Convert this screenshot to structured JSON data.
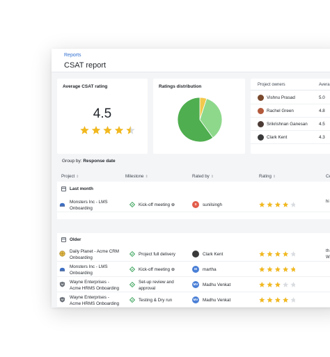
{
  "header": {
    "breadcrumb": "Reports",
    "title": "CSAT report"
  },
  "average_card": {
    "title": "Average CSAT rating",
    "value": "4.5",
    "stars": 4.5
  },
  "distribution_card": {
    "title": "Ratings distribution",
    "chart_data": {
      "type": "pie",
      "slices": [
        {
          "fraction": 0.05,
          "color": "#f2c94c"
        },
        {
          "fraction": 0.35,
          "color": "#8ed88c"
        },
        {
          "fraction": 0.6,
          "color": "#4fae4f"
        }
      ]
    }
  },
  "owners_card": {
    "col_name": "Project owners",
    "col_avg": "Avera",
    "rows": [
      {
        "name": "Vishnu Prasad",
        "value": "5.0",
        "avatar_color": "#7a4a2e"
      },
      {
        "name": "Rachel Green",
        "value": "4.8",
        "avatar_color": "#b25a3c"
      },
      {
        "name": "Srikrishnan Ganesan",
        "value": "4.5",
        "avatar_color": "#4b3b34"
      },
      {
        "name": "Clark Kent",
        "value": "4.3",
        "avatar_color": "#3a3a3a"
      }
    ]
  },
  "groupby": {
    "label": "Group by:",
    "value": "Response date"
  },
  "table": {
    "columns": {
      "project": "Project",
      "milestone": "Milestone",
      "rated_by": "Rated by",
      "rating": "Rating",
      "ce": "Ce"
    },
    "groups": [
      {
        "label": "Last month",
        "rows": [
          {
            "project_1": "Monsters Inc - LMS",
            "project_2": "Onboarding",
            "icon": "monster-logo-icon",
            "milestone_1": "Kick-off meeting ⊕",
            "milestone_2": "",
            "rater": "sunilsingh",
            "rater_initials": "S",
            "rater_color": "#e25c4a",
            "rating": 4,
            "ce_1": "hi",
            "ce_2": ""
          }
        ]
      },
      {
        "label": "Older",
        "rows": [
          {
            "project_1": "Daily Planet - Acme CRM",
            "project_2": "Onboarding",
            "icon": "globe-logo-icon",
            "milestone_1": "Project full delivery",
            "milestone_2": "",
            "rater": "Clark Kent",
            "rater_initials": "",
            "rater_color": "#3a3a3a",
            "rating": 4,
            "ce_1": "th",
            "ce_2": "W"
          },
          {
            "project_1": "Monsters Inc - LMS",
            "project_2": "Onboarding",
            "icon": "monster-logo-icon",
            "milestone_1": "Kick-off meeting ⊕",
            "milestone_2": "",
            "rater": "martha",
            "rater_initials": "M",
            "rater_color": "#4a7fd6",
            "rating": 5,
            "ce_1": "",
            "ce_2": ""
          },
          {
            "project_1": "Wayne Enterprises -",
            "project_2": "Acme HRMS Onboarding",
            "icon": "shield-logo-icon",
            "milestone_1": "Set-up review and",
            "milestone_2": "approval",
            "rater": "Madhu Venkat",
            "rater_initials": "MV",
            "rater_color": "#4a7fd6",
            "rating": 3,
            "ce_1": "",
            "ce_2": ""
          },
          {
            "project_1": "Wayne Enterprises -",
            "project_2": "Acme HRMS Onboarding",
            "icon": "shield-logo-icon",
            "milestone_1": "Testing & Dry run",
            "milestone_2": "",
            "rater": "Madhu Venkat",
            "rater_initials": "MV",
            "rater_color": "#4a7fd6",
            "rating": 4,
            "ce_1": "",
            "ce_2": ""
          }
        ]
      }
    ]
  },
  "colors": {
    "star_on": "#f2b81d",
    "star_off": "#d9dce0",
    "link": "#2f6fd1"
  }
}
